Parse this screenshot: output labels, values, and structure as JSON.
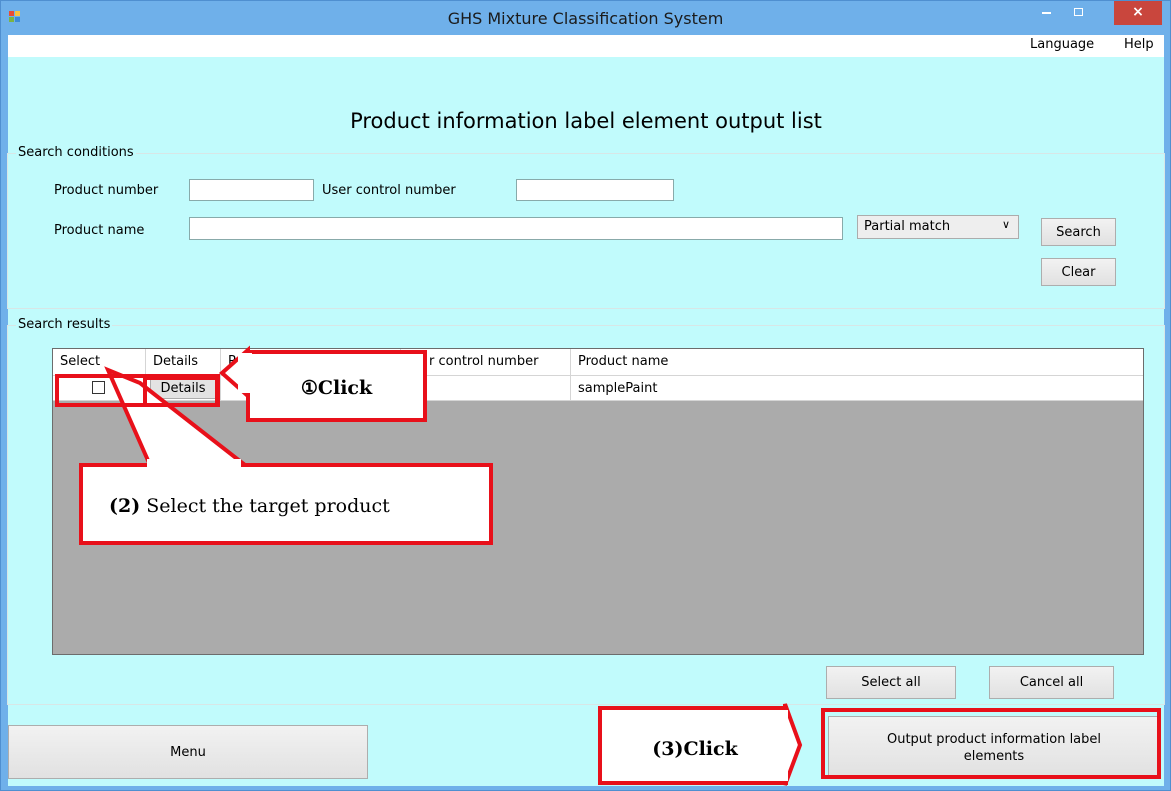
{
  "window": {
    "title": "GHS Mixture Classification System",
    "minimize_icon": "minimize-icon",
    "maximize_icon": "maximize-icon",
    "close_symbol": "×"
  },
  "menu": {
    "language": "Language",
    "help": "Help"
  },
  "page_title": "Product information label element output list",
  "search": {
    "group_label": "Search conditions",
    "product_number_label": "Product number",
    "product_number_value": "",
    "user_control_label": "User control number",
    "user_control_value": "",
    "product_name_label": "Product name",
    "product_name_value": "",
    "match_mode": "Partial match",
    "search_button": "Search",
    "clear_button": "Clear"
  },
  "results": {
    "group_label": "Search results",
    "columns": [
      "Select",
      "Details",
      "P",
      "r control number",
      "Product name"
    ],
    "rows": [
      {
        "selected": false,
        "details_button": "Details",
        "product_name": "samplePaint"
      }
    ],
    "select_all_button": "Select all",
    "cancel_all_button": "Cancel all"
  },
  "footer": {
    "menu_button": "Menu",
    "output_button_line1": "Output product information label",
    "output_button_line2": "elements"
  },
  "annotations": {
    "callout1": "①Click",
    "callout2_num": "(2)",
    "callout2_text": " Select the target product",
    "callout3": "(3)Click",
    "color": "#e8101a"
  }
}
